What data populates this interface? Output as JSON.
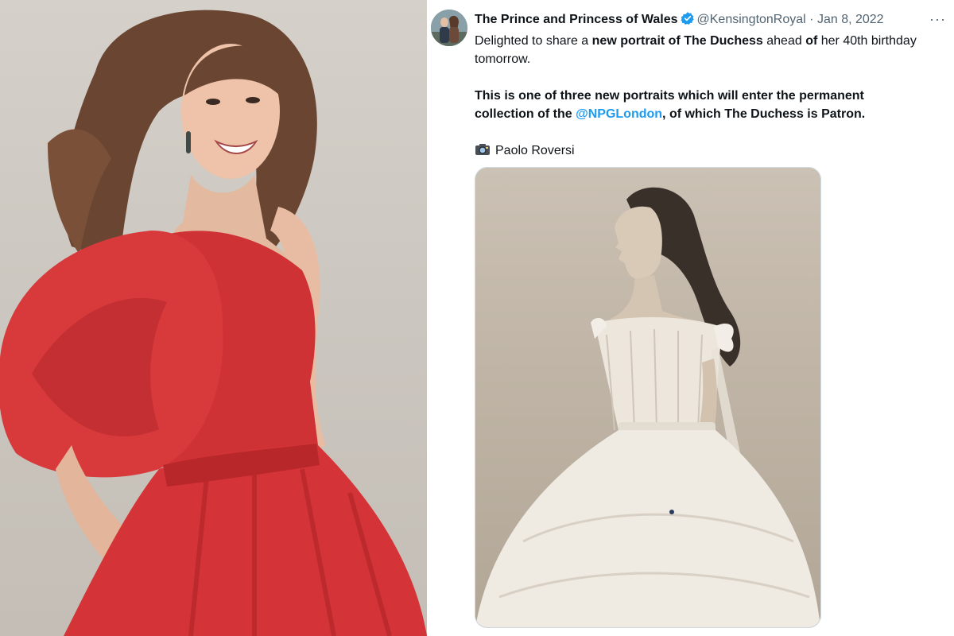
{
  "left_image": {
    "description_icon": "portrait-photo"
  },
  "tweet": {
    "author_name": "The Prince and Princess of Wales",
    "handle": "@KensingtonRoyal",
    "separator": "·",
    "date": "Jan 8, 2022",
    "more": "···",
    "paragraph1": {
      "t1": "Delighted to share a ",
      "b1": "new portrait of The Duchess",
      "t2": " ahead ",
      "b2": "of",
      "t3": " her 40th birthday tomorrow."
    },
    "paragraph2": {
      "t1": "This is one of three new portraits which will enter the permanent collection of the ",
      "mention": "@NPGLondon",
      "t2": ", of which The Duchess is Patron."
    },
    "credit": "Paolo Roversi"
  },
  "colors": {
    "text": "#0f1419",
    "secondary": "#536471",
    "link": "#1d9bf0",
    "verified": "#1d9bf0",
    "dress_red": "#d63a3a"
  },
  "icons": {
    "verified": "verified-badge-icon",
    "camera": "camera-icon",
    "more": "more-options-icon"
  }
}
